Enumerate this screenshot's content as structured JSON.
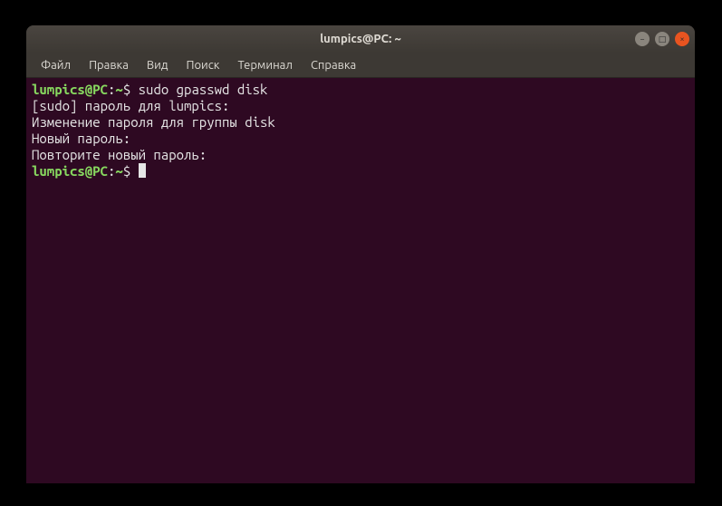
{
  "window": {
    "title": "lumpics@PC: ~"
  },
  "window_controls": {
    "minimize_glyph": "−",
    "maximize_glyph": "□",
    "close_glyph": "×"
  },
  "menu": {
    "items": [
      "Файл",
      "Правка",
      "Вид",
      "Поиск",
      "Терминал",
      "Справка"
    ]
  },
  "prompt": {
    "userhost": "lumpics@PC",
    "sep": ":",
    "path": "~",
    "dollar": "$"
  },
  "terminal": {
    "lines": [
      {
        "type": "prompt",
        "cmd": "sudo gpasswd disk"
      },
      {
        "type": "text",
        "text": "[sudo] пароль для lumpics:"
      },
      {
        "type": "text",
        "text": "Изменение пароля для группы disk"
      },
      {
        "type": "text",
        "text": "Новый пароль:"
      },
      {
        "type": "text",
        "text": "Повторите новый пароль:"
      },
      {
        "type": "prompt",
        "cmd": "",
        "cursor": true
      }
    ]
  }
}
